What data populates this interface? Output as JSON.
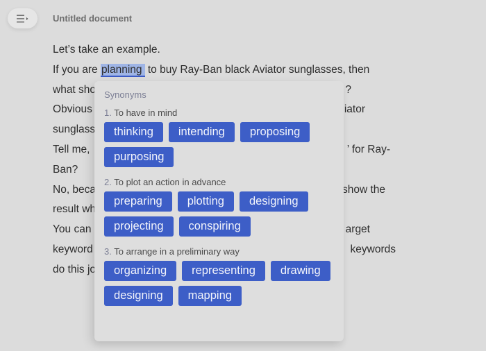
{
  "header": {
    "menu_icon": "hamburger-menu-icon",
    "title": "Untitled document"
  },
  "document": {
    "paragraphs": [
      {
        "text": "Let’s take an example."
      },
      {
        "before": "If you are ",
        "highlighted": "planning",
        "after": " to buy Ray-Ban black Aviator sunglasses, then"
      },
      {
        "left": "what sho",
        "right": "?"
      },
      {
        "left": "Obvious",
        "right": "iator"
      },
      {
        "left": "sunglass",
        "right": ""
      },
      {
        "left": "Tell me,",
        "right": "’ for Ray-"
      },
      {
        "left": "Ban?",
        "right": ""
      },
      {
        "left": "No, beca",
        "right": "show the"
      },
      {
        "left": "result wh",
        "right": ""
      },
      {
        "left": "You can",
        "right": "arget"
      },
      {
        "left": "keyword",
        "right": "keywords"
      },
      {
        "left": "do this jo",
        "right": ""
      }
    ]
  },
  "synonyms_popup": {
    "title": "Synonyms",
    "groups": [
      {
        "number": "1.",
        "label": "To have in mind",
        "words": [
          "thinking",
          "intending",
          "proposing",
          "purposing"
        ]
      },
      {
        "number": "2.",
        "label": "To plot an action in advance",
        "words": [
          "preparing",
          "plotting",
          "designing",
          "projecting",
          "conspiring"
        ]
      },
      {
        "number": "3.",
        "label": "To arrange in a preliminary way",
        "words": [
          "organizing",
          "representing",
          "drawing",
          "designing",
          "mapping"
        ]
      }
    ]
  },
  "colors": {
    "background": "#dcdcdc",
    "chip": "#3d5ec7",
    "highlight": "#9fb5e6",
    "accent_underline": "#3b5bc6"
  }
}
